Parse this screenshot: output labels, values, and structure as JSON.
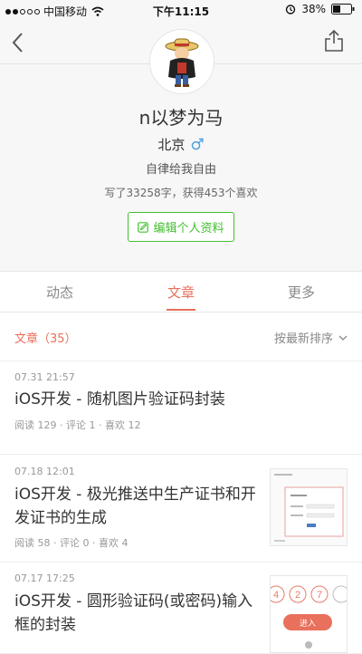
{
  "status_bar": {
    "carrier": "中国移动",
    "time": "下午11:15",
    "battery": "38%"
  },
  "profile": {
    "username": "n以梦为马",
    "location": "北京",
    "gender_symbol": "♂",
    "bio": "自律给我自由",
    "stats": "写了33258字，获得453个喜欢",
    "edit_label": "编辑个人资料"
  },
  "tabs": [
    {
      "label": "动态"
    },
    {
      "label": "文章"
    },
    {
      "label": "更多"
    }
  ],
  "list": {
    "count_label": "文章（35）",
    "sort_label": "按最新排序"
  },
  "articles": [
    {
      "time": "07.31 21:57",
      "title_line1": "iOS开发 - 随机图片验证码封装",
      "title_line2": "",
      "meta": "阅读 129 · 评论 1 · 喜欢 12"
    },
    {
      "time": "07.18 12:01",
      "title_line1": "iOS开发 - 极光推送中生产证书和开",
      "title_line2": "发证书的生成",
      "meta": "阅读 58 · 评论 0 · 喜欢 4"
    },
    {
      "time": "07.17 17:25",
      "title_line1": "iOS开发 - 圆形验证码(或密码)输入",
      "title_line2": "框的封装",
      "meta": "",
      "thumb_digits": [
        "4",
        "2",
        "7"
      ],
      "thumb_button": "进入"
    }
  ],
  "colors": {
    "accent": "#ea6f5a",
    "green": "#42c02e",
    "gender_blue": "#4aa0e0"
  }
}
